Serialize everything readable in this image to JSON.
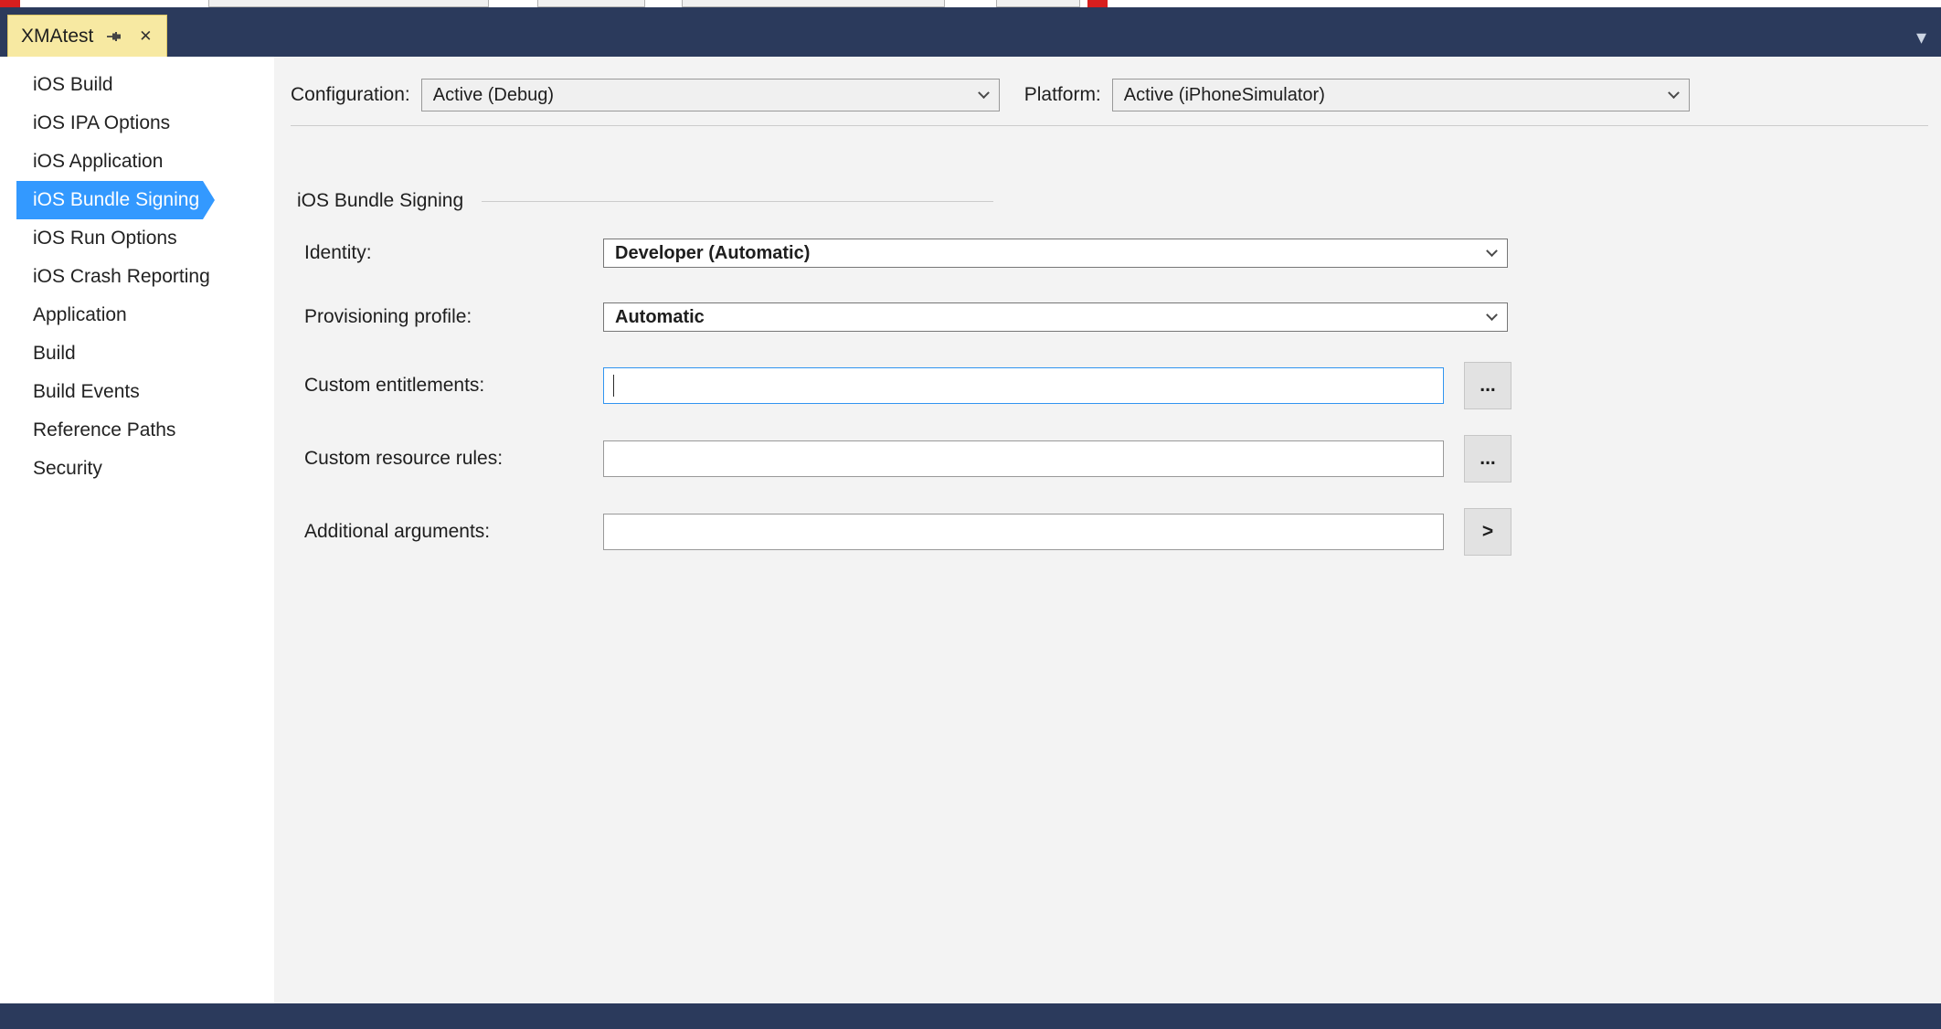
{
  "window": {
    "tab_title": "XMAtest"
  },
  "toolbar": {
    "configuration_label": "Configuration:",
    "configuration_value": "Active (Debug)",
    "platform_label": "Platform:",
    "platform_value": "Active (iPhoneSimulator)"
  },
  "sidebar": {
    "items": [
      "iOS Build",
      "iOS IPA Options",
      "iOS Application",
      "iOS Bundle Signing",
      "iOS Run Options",
      "iOS Crash Reporting",
      "Application",
      "Build",
      "Build Events",
      "Reference Paths",
      "Security"
    ],
    "selected_index": 3
  },
  "form": {
    "section_title": "iOS Bundle Signing",
    "rows": [
      {
        "label": "Identity:",
        "value": "Developer (Automatic)"
      },
      {
        "label": "Provisioning profile:",
        "value": "Automatic"
      },
      {
        "label": "Custom entitlements:",
        "value": "",
        "button": "...",
        "focused": true
      },
      {
        "label": "Custom resource rules:",
        "value": "",
        "button": "..."
      },
      {
        "label": "Additional arguments:",
        "value": "",
        "button": ">"
      }
    ]
  },
  "icons": {
    "close": "✕",
    "overflow": "▾"
  },
  "colors": {
    "title_bar": "#2b3a5c",
    "active_tab": "#f7e9a2",
    "selection_blue": "#3399ff",
    "focus_border": "#3094f0"
  }
}
